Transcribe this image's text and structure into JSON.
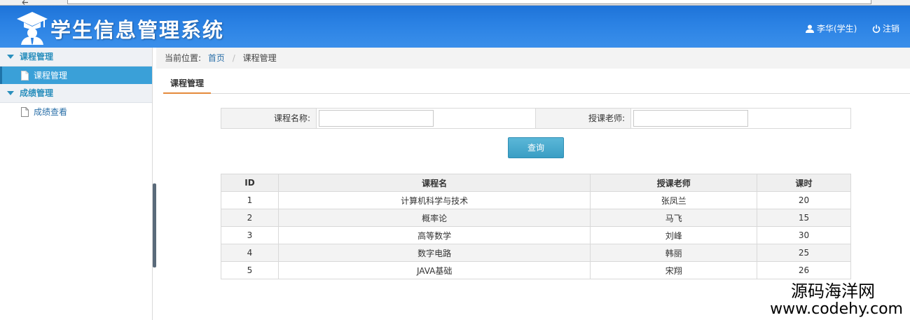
{
  "header": {
    "title": "学生信息管理系统",
    "user_label": "李华(学生)",
    "logout_label": "注销"
  },
  "sidebar": {
    "groups": [
      {
        "label": "课程管理",
        "items": [
          {
            "label": "课程管理",
            "active": true
          }
        ]
      },
      {
        "label": "成绩管理",
        "items": [
          {
            "label": "成绩查看",
            "active": false
          }
        ]
      }
    ]
  },
  "breadcrumb": {
    "prefix": "当前位置:",
    "home": "首页",
    "separator": "/",
    "current": "课程管理"
  },
  "tab": {
    "label": "课程管理"
  },
  "search": {
    "course_name_label": "课程名称:",
    "course_name_value": "",
    "teacher_label": "授课老师:",
    "teacher_value": "",
    "query_button": "查询"
  },
  "table": {
    "headers": [
      "ID",
      "课程名",
      "授课老师",
      "课时"
    ],
    "rows": [
      [
        "1",
        "计算机科学与技术",
        "张凤兰",
        "20"
      ],
      [
        "2",
        "概率论",
        "马飞",
        "15"
      ],
      [
        "3",
        "高等数学",
        "刘峰",
        "30"
      ],
      [
        "4",
        "数字电路",
        "韩丽",
        "25"
      ],
      [
        "5",
        "JAVA基础",
        "宋翔",
        "26"
      ]
    ]
  },
  "watermark": {
    "line1": "源码海洋网",
    "line2": "www.codehy.com"
  },
  "colors": {
    "header_blue": "#2b82e4",
    "accent_cyan": "#3aa0d8",
    "tab_underline": "#e58a3b",
    "link": "#2a6fa8"
  },
  "icons": {
    "logo": "graduate-cap-icon",
    "user": "user-icon",
    "logout": "power-icon",
    "menu_item": "document-icon",
    "group": "triangle-down-icon"
  }
}
